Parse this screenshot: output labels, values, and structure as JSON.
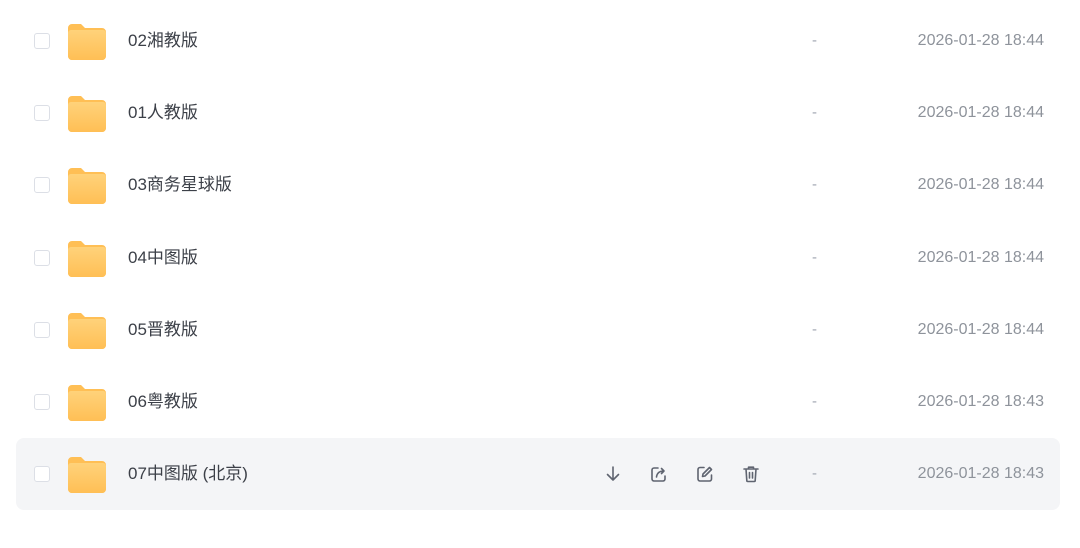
{
  "files": [
    {
      "name": "02湘教版",
      "size": "-",
      "modified": "2026-01-28 18:44",
      "icon": "folder-icon",
      "hovered": false
    },
    {
      "name": "01人教版",
      "size": "-",
      "modified": "2026-01-28 18:44",
      "icon": "folder-icon",
      "hovered": false
    },
    {
      "name": "03商务星球版",
      "size": "-",
      "modified": "2026-01-28 18:44",
      "icon": "folder-icon",
      "hovered": false
    },
    {
      "name": "04中图版",
      "size": "-",
      "modified": "2026-01-28 18:44",
      "icon": "folder-icon",
      "hovered": false
    },
    {
      "name": "05晋教版",
      "size": "-",
      "modified": "2026-01-28 18:44",
      "icon": "folder-icon",
      "hovered": false
    },
    {
      "name": "06粤教版",
      "size": "-",
      "modified": "2026-01-28 18:43",
      "icon": "folder-icon",
      "hovered": false
    },
    {
      "name": "07中图版 (北京)",
      "size": "-",
      "modified": "2026-01-28 18:43",
      "icon": "folder-icon",
      "hovered": true
    }
  ],
  "row_actions": [
    "download-icon",
    "share-icon",
    "edit-icon",
    "trash-icon"
  ],
  "colors": {
    "folder_top": "#ffd27a",
    "folder_bottom": "#ffbf55",
    "hover_background": "#f4f5f7",
    "name_text": "#3c4048",
    "meta_text": "#8e939b",
    "action_icon": "#5f6470"
  }
}
